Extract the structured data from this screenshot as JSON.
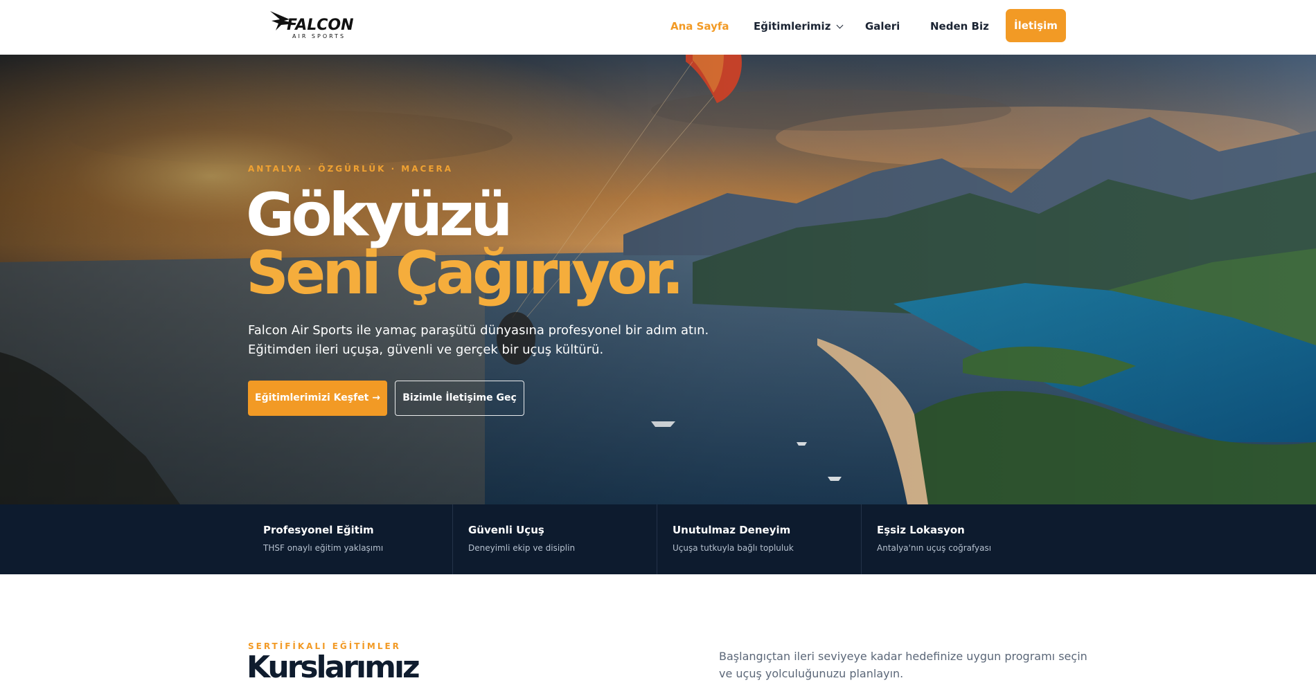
{
  "brand": {
    "name": "FALCON",
    "tagline": "AIR SPORTS"
  },
  "nav": {
    "items": [
      {
        "label": "Ana Sayfa",
        "active": true
      },
      {
        "label": "Eğitimlerimiz",
        "has_dropdown": true
      },
      {
        "label": "Galeri"
      },
      {
        "label": "Neden Biz"
      }
    ],
    "cta_label": "İletişim"
  },
  "hero": {
    "eyebrow": "ANTALYA · ÖZGÜRLÜK · MACERA",
    "title_line1": "Gökyüzü",
    "title_line2": "Seni Çağırıyor.",
    "lead_line1": "Falcon Air Sports ile yamaç paraşütü dünyasına profesyonel bir adım atın.",
    "lead_line2": "Eğitimden ileri uçuşa, güvenli ve gerçek bir uçuş kültürü.",
    "primary_button": "Eğitimlerimizi Keşfet →",
    "secondary_button": "Bizimle İletişime Geç"
  },
  "features": [
    {
      "title": "Profesyonel Eğitim",
      "desc": "THSF onaylı eğitim yaklaşımı"
    },
    {
      "title": "Güvenli Uçuş",
      "desc": "Deneyimli ekip ve disiplin"
    },
    {
      "title": "Unutulmaz Deneyim",
      "desc": "Uçuşa tutkuyla bağlı topluluk"
    },
    {
      "title": "Eşsiz Lokasyon",
      "desc": "Antalya'nın uçuş coğrafyası"
    }
  ],
  "courses": {
    "eyebrow": "SERTİFİKALI EĞİTİMLER",
    "title": "Kurslarımız",
    "text_line1": "Başlangıçtan ileri seviyeye kadar hedefinize uygun programı seçin",
    "text_line2": "ve uçuş yolculuğunuzu planlayın."
  },
  "colors": {
    "accent": "#f29a25",
    "navy": "#0d1b2e",
    "hero_accent_text": "#f5ad3c"
  }
}
